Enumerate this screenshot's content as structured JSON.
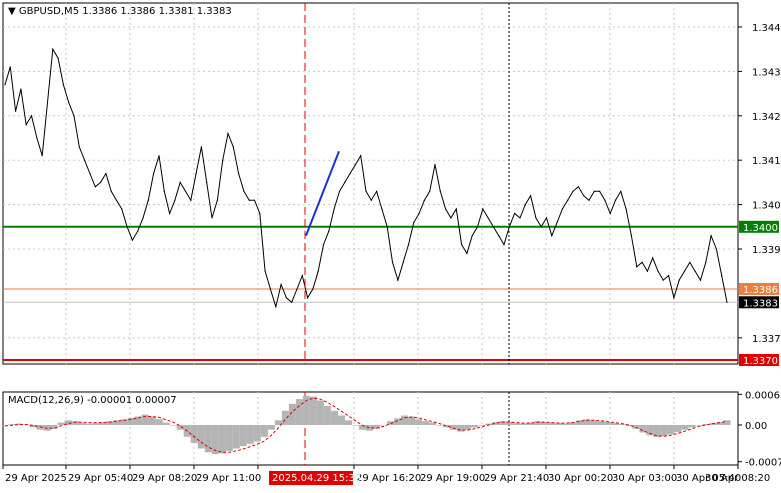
{
  "window": {
    "symbol_header": "GBPUSD,M5",
    "ohlc": "1.3386 1.3386 1.3381 1.3383"
  },
  "colors": {
    "background": "#ffffff",
    "grid": "#c8c8c8",
    "axis": "#000000",
    "price_line": "#000000",
    "trend_segment": "#1f2fcf",
    "level_green": "#008000",
    "level_orange": "#f27a3a",
    "level_red": "#e00000",
    "current_price_line": "#c0c0c0",
    "session_marker": "#e00000",
    "macd_hist": "#b4b4b4",
    "macd_signal": "#e00000"
  },
  "chart_data": [
    {
      "type": "line",
      "title": "GBPUSD,M5 1.3386 1.3386 1.3381 1.3383",
      "ylim": [
        1.33691,
        1.34504
      ],
      "y_ticks": [
        "1.3445",
        "1.3435",
        "1.3425",
        "1.3415",
        "1.3405",
        "1.3395",
        "1.3375"
      ],
      "x_ticks": [
        "29 Apr 2025",
        "29 Apr 05:40",
        "29 Apr 08:20",
        "29 Apr 11:00",
        "29 Apr 16:20",
        "29 Apr 19:00",
        "29 Apr 21:40",
        "30 Apr 00:20",
        "30 Apr 03:00",
        "30 Apr 05:40",
        "30 Apr 08:20"
      ],
      "x_highlight": "2025.04.29 15:35",
      "levels": [
        {
          "value": 1.34,
          "label": "1.3400",
          "color": "green"
        },
        {
          "value": 1.3386,
          "label": "1.3386",
          "color": "orange"
        },
        {
          "value": 1.337,
          "label": "1.3370",
          "color": "red"
        }
      ],
      "current_price": {
        "value": 1.3383,
        "label": "1.3383"
      },
      "trend_segment": {
        "from": 1.3398,
        "to": 1.3417
      },
      "close": [
        1.3432,
        1.3436,
        1.3426,
        1.3431,
        1.3423,
        1.3425,
        1.342,
        1.3416,
        1.3428,
        1.344,
        1.3438,
        1.3432,
        1.3428,
        1.3425,
        1.3418,
        1.3415,
        1.3412,
        1.3409,
        1.341,
        1.3412,
        1.3408,
        1.3406,
        1.3404,
        1.34,
        1.3397,
        1.3399,
        1.3402,
        1.3406,
        1.3412,
        1.3416,
        1.3408,
        1.3403,
        1.3406,
        1.341,
        1.3408,
        1.3406,
        1.3412,
        1.3418,
        1.341,
        1.3402,
        1.3406,
        1.3415,
        1.3421,
        1.3418,
        1.3412,
        1.3408,
        1.3406,
        1.3406,
        1.3403,
        1.339,
        1.3386,
        1.3382,
        1.3387,
        1.3384,
        1.3383,
        1.3386,
        1.3389,
        1.3384,
        1.3386,
        1.339,
        1.3396,
        1.3399,
        1.3404,
        1.3408,
        1.341,
        1.3412,
        1.3414,
        1.3416,
        1.3408,
        1.3406,
        1.3408,
        1.3404,
        1.34,
        1.3392,
        1.3388,
        1.3392,
        1.3396,
        1.3401,
        1.3403,
        1.3406,
        1.3408,
        1.3414,
        1.3408,
        1.3404,
        1.3402,
        1.3404,
        1.3396,
        1.3394,
        1.3398,
        1.34,
        1.3404,
        1.3402,
        1.34,
        1.3398,
        1.3396,
        1.34,
        1.3403,
        1.3402,
        1.3405,
        1.3407,
        1.3402,
        1.34,
        1.3402,
        1.3398,
        1.3401,
        1.3404,
        1.3406,
        1.3408,
        1.3409,
        1.3407,
        1.3406,
        1.3408,
        1.3408,
        1.3406,
        1.3403,
        1.3406,
        1.3408,
        1.3404,
        1.3398,
        1.3391,
        1.3392,
        1.339,
        1.3393,
        1.339,
        1.3388,
        1.3389,
        1.3384,
        1.3388,
        1.339,
        1.3392,
        1.339,
        1.3388,
        1.3392,
        1.3398,
        1.3395,
        1.3389,
        1.3383
      ]
    },
    {
      "type": "bar",
      "title": "MACD(12,26,9) -0.00001 0.00007",
      "ylim": [
        -0.00085,
        0.0007
      ],
      "y_ticks": [
        "0.00065",
        "0.00",
        "-0.00078"
      ],
      "zero_label": "0.00",
      "macd_hist": [
        0.0,
        2e-05,
        3e-05,
        1e-05,
        -5e-05,
        -0.0001,
        -0.00012,
        -8e-05,
        5e-05,
        0.0001,
        8e-05,
        5e-05,
        3e-05,
        4e-05,
        6e-05,
        8e-05,
        0.0001,
        0.00012,
        0.00015,
        0.00018,
        0.00022,
        0.00018,
        0.00012,
        5e-05,
        0.0,
        -0.0001,
        -0.00025,
        -0.00038,
        -0.0005,
        -0.00058,
        -0.00062,
        -0.0006,
        -0.00055,
        -0.0005,
        -0.00045,
        -0.0004,
        -0.00035,
        -0.00025,
        -0.0001,
        0.0001,
        0.0003,
        0.00045,
        0.00055,
        0.00062,
        0.0006,
        0.00052,
        0.0004,
        0.0003,
        0.0002,
        0.0001,
        0.0,
        -0.0001,
        -0.00012,
        -8e-05,
        0.0,
        8e-05,
        0.00014,
        0.0002,
        0.00018,
        0.00012,
        8e-05,
        5e-05,
        0.0,
        -5e-05,
        -0.0001,
        -0.00014,
        -0.0001,
        -5e-05,
        0.0,
        3e-05,
        6e-05,
        8e-05,
        6e-05,
        4e-05,
        3e-05,
        5e-05,
        8e-05,
        6e-05,
        5e-05,
        4e-05,
        3e-05,
        6e-05,
        0.0001,
        0.00012,
        0.0001,
        8e-05,
        6e-05,
        4e-05,
        2e-05,
        -2e-05,
        -8e-05,
        -0.00016,
        -0.00022,
        -0.00026,
        -0.00024,
        -0.0002,
        -0.00015,
        -0.0001,
        -5e-05,
        0.0,
        2e-05,
        4e-05,
        6e-05,
        0.0001
      ],
      "macd_signal": [
        -2e-05,
        -1e-05,
        1e-05,
        1e-05,
        -1e-05,
        -4e-05,
        -7e-05,
        -7e-05,
        -2e-05,
        3e-05,
        6e-05,
        6e-05,
        5e-05,
        5e-05,
        5e-05,
        6e-05,
        8e-05,
        0.0001,
        0.00012,
        0.00015,
        0.00018,
        0.00018,
        0.00016,
        0.00011,
        6e-05,
        -2e-05,
        -0.00013,
        -0.00025,
        -0.00037,
        -0.00047,
        -0.00054,
        -0.00058,
        -0.00058,
        -0.00055,
        -0.00051,
        -0.00046,
        -0.00041,
        -0.00034,
        -0.00022,
        -6e-05,
        0.00012,
        0.00028,
        0.00041,
        0.00052,
        0.00057,
        0.00055,
        0.00048,
        0.00039,
        0.00029,
        0.00019,
        9e-05,
        -1e-05,
        -6e-05,
        -7e-05,
        -3e-05,
        3e-05,
        9e-05,
        0.00015,
        0.00017,
        0.00015,
        0.00011,
        7e-05,
        3e-05,
        -2e-05,
        -7e-05,
        -0.00011,
        -0.00011,
        -8e-05,
        -4e-05,
        0.0,
        4e-05,
        6e-05,
        6e-05,
        5e-05,
        4e-05,
        4e-05,
        6e-05,
        6e-05,
        5e-05,
        4e-05,
        4e-05,
        5e-05,
        8e-05,
        0.0001,
        0.0001,
        9e-05,
        7e-05,
        5e-05,
        3e-05,
        0.0,
        -5e-05,
        -0.00012,
        -0.00018,
        -0.00023,
        -0.00024,
        -0.00022,
        -0.00018,
        -0.00013,
        -8e-05,
        -3e-05,
        0.0,
        3e-05,
        5e-05,
        8e-05
      ]
    }
  ]
}
